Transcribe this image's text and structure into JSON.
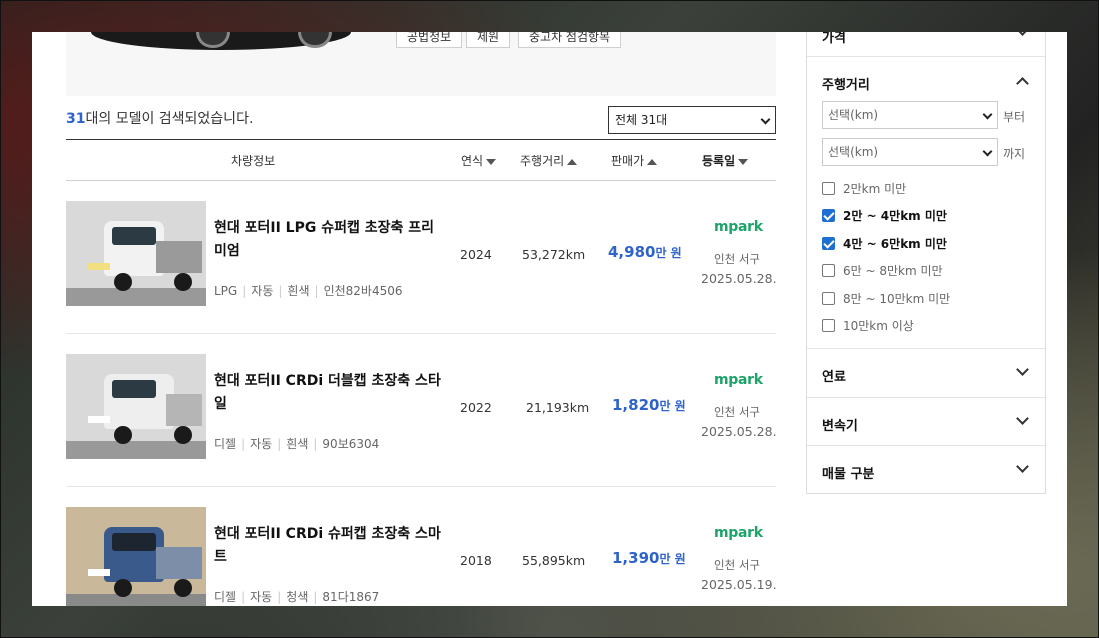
{
  "top_buttons": [
    "공법정보",
    "제원",
    "중고차 점검항목"
  ],
  "results": {
    "count": "31",
    "suffix": "대의 모델이 검색되었습니다.",
    "select_value": "전체 31대"
  },
  "table_headers": {
    "vehicle": "차량정보",
    "year": "연식",
    "mileage": "주행거리",
    "price": "판매가",
    "date": "등록일"
  },
  "rows": [
    {
      "title": "현대 포터II LPG 슈퍼캡 초장축 프리미엄",
      "meta": [
        "LPG",
        "자동",
        "흰색",
        "인천82바4506"
      ],
      "year": "2024",
      "km": "53,272km",
      "price": "4,980",
      "price_unit": "만 원",
      "dealer": "mpark",
      "location": "인천 서구",
      "date": "2025.05.28.",
      "color": "#f2f2f2"
    },
    {
      "title": "현대 포터II CRDi 더블캡 초장축 스타일",
      "meta": [
        "디젤",
        "자동",
        "흰색",
        "90보6304"
      ],
      "year": "2022",
      "km": "21,193km",
      "price": "1,820",
      "price_unit": "만 원",
      "dealer": "mpark",
      "location": "인천 서구",
      "date": "2025.05.28.",
      "color": "#eeeeee"
    },
    {
      "title": "현대 포터II CRDi 슈퍼캡 초장축 스마트",
      "meta": [
        "디젤",
        "자동",
        "청색",
        "81다1867"
      ],
      "year": "2018",
      "km": "55,895km",
      "price": "1,390",
      "price_unit": "만 원",
      "dealer": "mpark",
      "location": "인천 서구",
      "date": "2025.05.19.",
      "color": "#3b5a8c"
    }
  ],
  "sidebar": {
    "price_label": "가격",
    "mileage": {
      "label": "주행거리",
      "from_placeholder": "선택(km)",
      "from_suffix": "부터",
      "to_placeholder": "선택(km)",
      "to_suffix": "까지",
      "options": [
        {
          "label": "2만km 미만",
          "checked": false
        },
        {
          "label": "2만 ~ 4만km 미만",
          "checked": true
        },
        {
          "label": "4만 ~ 6만km 미만",
          "checked": true
        },
        {
          "label": "6만 ~ 8만km 미만",
          "checked": false
        },
        {
          "label": "8만 ~ 10만km 미만",
          "checked": false
        },
        {
          "label": "10만km 이상",
          "checked": false
        }
      ]
    },
    "fuel_label": "연료",
    "transmission_label": "변속기",
    "listing_type_label": "매물 구분"
  }
}
